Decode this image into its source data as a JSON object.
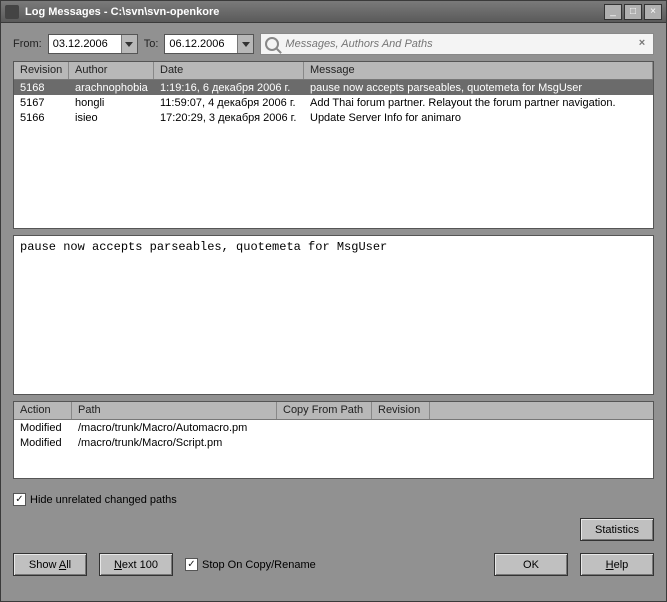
{
  "window": {
    "title": "Log Messages - C:\\svn\\svn-openkore"
  },
  "filter": {
    "from_label": "From:",
    "from_value": "03.12.2006",
    "to_label": "To:",
    "to_value": "06.12.2006",
    "search_placeholder": "Messages, Authors And Paths"
  },
  "columns": {
    "revision": "Revision",
    "author": "Author",
    "date": "Date",
    "message": "Message"
  },
  "rows": [
    {
      "rev": "5168",
      "author": "arachnophobia",
      "date": "1:19:16, 6 декабря 2006 г.",
      "msg": "pause now accepts parseables, quotemeta for MsgUser",
      "selected": true
    },
    {
      "rev": "5167",
      "author": "hongli",
      "date": "11:59:07, 4 декабря 2006 г.",
      "msg": "Add Thai forum partner. Relayout the forum partner navigation.",
      "selected": false
    },
    {
      "rev": "5166",
      "author": "isieo",
      "date": "17:20:29, 3 декабря 2006 г.",
      "msg": "Update Server Info for animaro",
      "selected": false
    }
  ],
  "detail": "pause now accepts parseables, quotemeta for MsgUser",
  "file_columns": {
    "action": "Action",
    "path": "Path",
    "copy": "Copy From Path",
    "rev": "Revision"
  },
  "files": [
    {
      "action": "Modified",
      "path": "/macro/trunk/Macro/Automacro.pm"
    },
    {
      "action": "Modified",
      "path": "/macro/trunk/Macro/Script.pm"
    }
  ],
  "checkbox": {
    "hide_label": "Hide unrelated changed paths",
    "checked": true
  },
  "buttons": {
    "statistics": "Statistics",
    "show_all": "Show All",
    "next100": "Next 100",
    "stop_label": "Stop On Copy/Rename",
    "stop_checked": true,
    "ok": "OK",
    "help": "Help"
  }
}
